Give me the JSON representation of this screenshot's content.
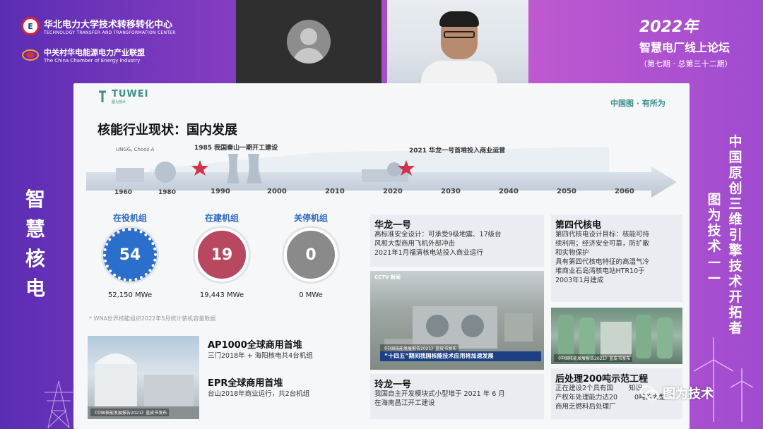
{
  "header": {
    "org1_name": "华北电力大学技术转移转化中心",
    "org1_en": "TECHNOLOGY TRANSFER AND TRANSFORMATION CENTER",
    "org2_name": "中关村华电能源电力产业联盟",
    "org2_en": "The China Chamber of Energy Industry",
    "forum_year": "2022年",
    "forum_name": "智慧电厂线上论坛",
    "forum_sub": "（第七期 · 总第三十二期）"
  },
  "side": {
    "left_vertical": [
      "智",
      "慧",
      "核",
      "电"
    ],
    "right_col1": [
      "图",
      "为",
      "技",
      "术",
      "—",
      "—"
    ],
    "right_col2": [
      "中",
      "国",
      "原",
      "创",
      "三",
      "维",
      "引",
      "擎",
      "技",
      "术",
      "开",
      "拓",
      "者"
    ]
  },
  "slide": {
    "brand": "TUWEI",
    "brand_sub": "图为技术",
    "slogan": "中国图 · 有所为",
    "title": "核能行业现状：国内发展",
    "timeline": {
      "years": [
        "1960",
        "1980",
        "1990",
        "2000",
        "2010",
        "2020",
        "2030",
        "2040",
        "2050",
        "2060"
      ],
      "reactor_label": "UNGG, Chooz A",
      "event1": "1985 我国秦山一期开工建设",
      "event2": "2021 华龙一号首堆投入商业运营"
    },
    "stats": [
      {
        "label": "在役机组",
        "count": "54",
        "capacity": "52,150 MWe",
        "color": "#2a6fcb"
      },
      {
        "label": "在建机组",
        "count": "19",
        "capacity": "19,443 MWe",
        "color": "#b8475f"
      },
      {
        "label": "关停机组",
        "count": "0",
        "capacity": "0 MWe",
        "color": "#8a8a8a"
      }
    ],
    "stats_note": "* WNA世界核能组织2022年5月统计装机容量数据",
    "ap_title": "AP1000全球商用首堆",
    "ap_text": "三门2018年 + 海阳核电共4台机组",
    "epr_title": "EPR全球商用首堆",
    "epr_text": "台山2018年商业运行，共2台机组",
    "photo1_caption": "《中国核能发展报告2021》蓝皮书发布",
    "hualong_title": "华龙一号",
    "hualong_text": [
      "高标准安全设计：可承受9级地震、17级台",
      "风和大型商用飞机外部冲击",
      "2021年1月福清核电站投入商业运行"
    ],
    "photo2_caption_top": "《中国核能发展报告2021》蓝皮书发布",
    "photo2_banner": "“十四五”期间我国核能技术应用将加速发展",
    "photo2_cctv": "CCTV 新闻",
    "linglong_title": "玲龙一号",
    "linglong_text": [
      "我国自主开发模块式小型堆于 2021 年 6 月",
      "在海南昌江开工建设"
    ],
    "gen4_title": "第四代核电",
    "gen4_text": [
      "第四代核电设计目标：核能可持",
      "续利用；经济安全可靠，防扩散",
      "和实物保护",
      "具有第四代核电特征的高温气冷",
      "堆商业石岛湾核电站HTR10于",
      "2003年1月建成"
    ],
    "photo3_caption": "《中国核能发展报告2021》蓝皮书发布",
    "post_title": "后处理200吨示范工程",
    "post_text": [
      "正在建设2个具有国",
      "产权年处理能力达20",
      "商用乏燃料后处理厂"
    ],
    "post_text_hidden": [
      "知识",
      "0吨的大型"
    ]
  },
  "watermark": {
    "text": "图为技术"
  },
  "colors": {
    "accent": "#3a8f8a",
    "blue": "#2a6fcb",
    "red_star": "#d2334a"
  }
}
